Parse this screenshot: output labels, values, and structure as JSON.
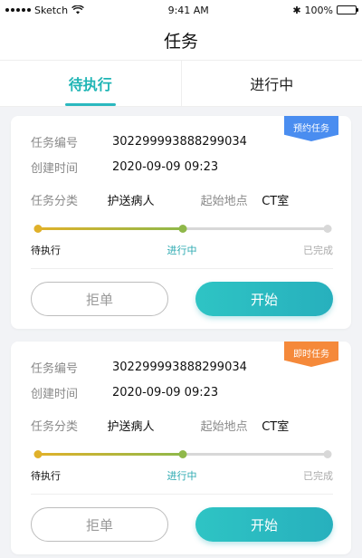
{
  "status_bar": {
    "carrier": "Sketch",
    "time": "9:41 AM",
    "battery": "100%",
    "battery_level": 1.0
  },
  "header": {
    "title": "任务"
  },
  "tabs": [
    {
      "label": "待执行",
      "active": true
    },
    {
      "label": "进行中",
      "active": false
    }
  ],
  "tasks": [
    {
      "badge": "预约任务",
      "badge_color": "#4a8df0",
      "id_label": "任务编号",
      "id_value": "302299993888299034",
      "created_label": "创建时间",
      "created_value": "2020-09-09 09:23",
      "category_label": "任务分类",
      "category_value": "护送病人",
      "origin_label": "起始地点",
      "origin_value": "CT室",
      "steps": [
        "待执行",
        "进行中",
        "已完成"
      ],
      "progress": 0.5,
      "reject_label": "拒单",
      "start_label": "开始"
    },
    {
      "badge": "即时任务",
      "badge_color": "#f5893a",
      "id_label": "任务编号",
      "id_value": "302299993888299034",
      "created_label": "创建时间",
      "created_value": "2020-09-09 09:23",
      "category_label": "任务分类",
      "category_value": "护送病人",
      "origin_label": "起始地点",
      "origin_value": "CT室",
      "steps": [
        "待执行",
        "进行中",
        "已完成"
      ],
      "progress": 0.5,
      "reject_label": "拒单",
      "start_label": "开始"
    }
  ],
  "colors": {
    "accent": "#2bb8bf",
    "step_done_start": "#e0b12a",
    "step_current": "#8fb84a",
    "step_pending": "#d8d8d8"
  }
}
